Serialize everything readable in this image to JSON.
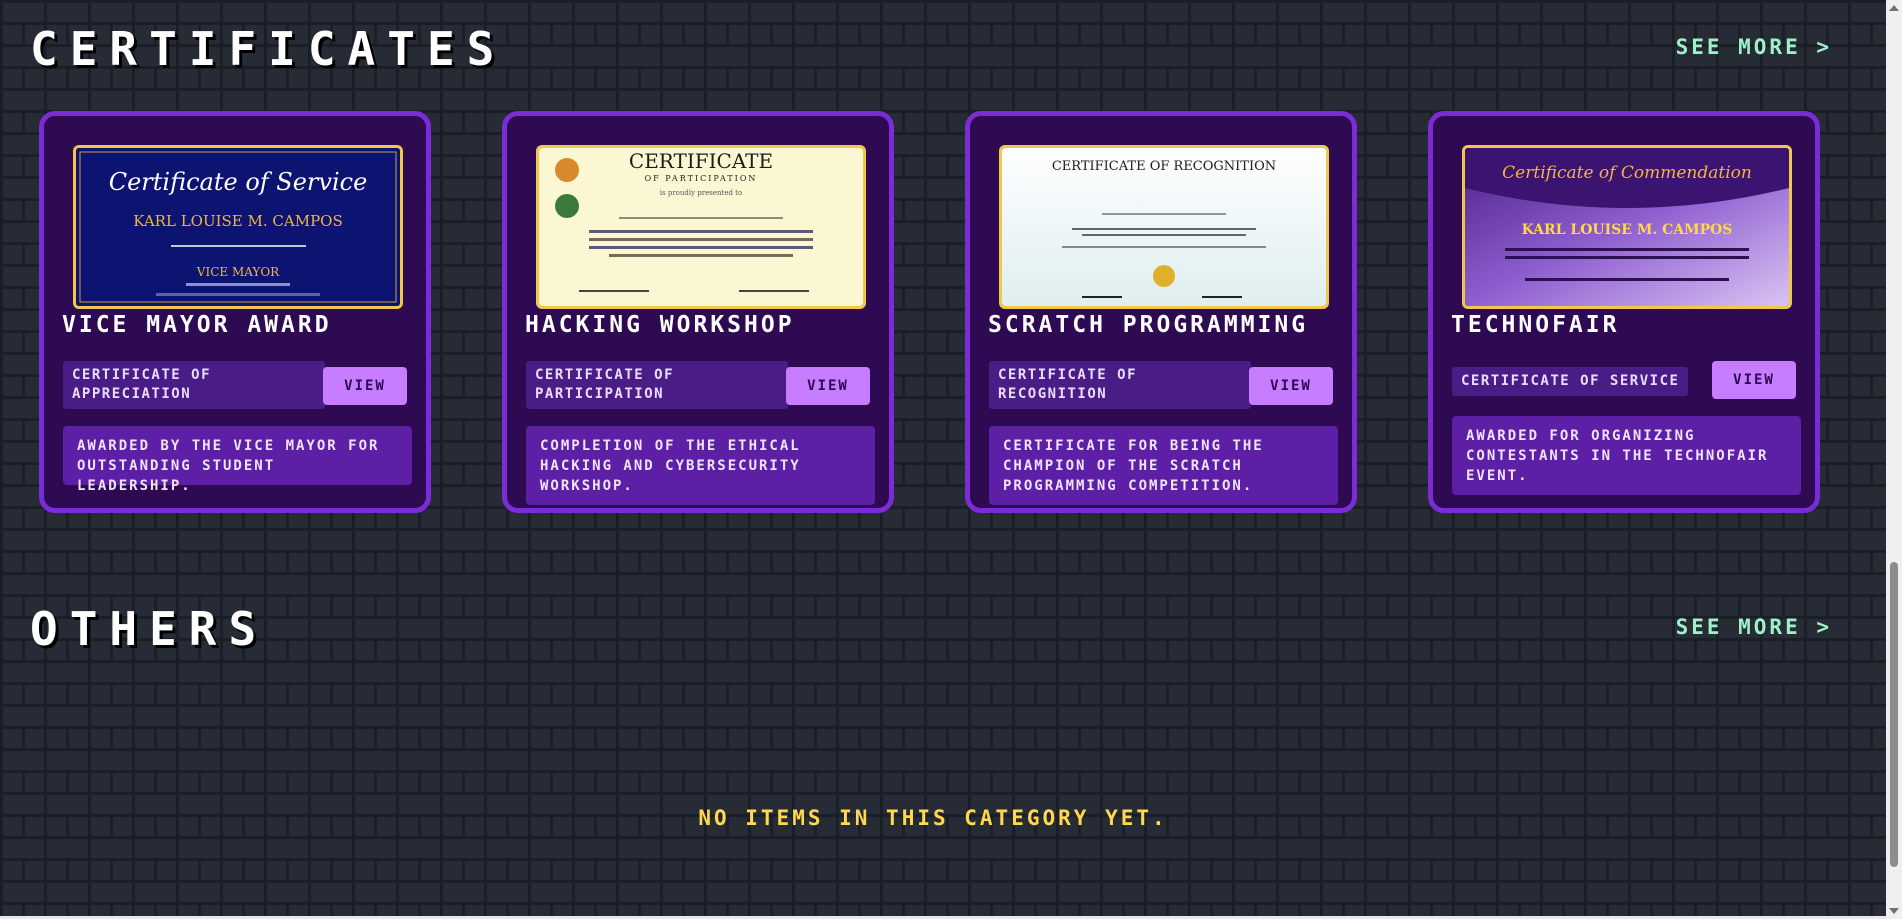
{
  "sections": {
    "certificates": {
      "title": "CERTIFICATES",
      "see_more": "SEE MORE >"
    },
    "others": {
      "title": "OTHERS",
      "see_more": "SEE MORE >",
      "empty_text": "NO ITEMS IN THIS CATEGORY YET."
    }
  },
  "cards": [
    {
      "title": "VICE MAYOR AWARD",
      "type": "CERTIFICATE OF APPRECIATION",
      "view_label": "VIEW",
      "description": "AWARDED BY THE VICE MAYOR FOR OUTSTANDING STUDENT LEADERSHIP.",
      "thumbnail": {
        "heading": "Certificate of Service",
        "name": "KARL LOUISE M. CAMPOS",
        "subtitle": "VICE MAYOR"
      }
    },
    {
      "title": "HACKING WORKSHOP",
      "type": "CERTIFICATE OF PARTICIPATION",
      "view_label": "VIEW",
      "description": "COMPLETION OF THE ETHICAL HACKING AND CYBERSECURITY WORKSHOP.",
      "thumbnail": {
        "heading": "CERTIFICATE",
        "subheading": "OF PARTICIPATION",
        "line": "is proudly presented to"
      }
    },
    {
      "title": "SCRATCH PROGRAMMING",
      "type": "CERTIFICATE OF RECOGNITION",
      "view_label": "VIEW",
      "description": "CERTIFICATE FOR BEING THE CHAMPION OF THE SCRATCH PROGRAMMING COMPETITION.",
      "thumbnail": {
        "heading": "CERTIFICATE OF RECOGNITION"
      }
    },
    {
      "title": "TECHNOFAIR",
      "type": "CERTIFICATE OF SERVICE",
      "view_label": "VIEW",
      "description": "AWARDED FOR ORGANIZING CONTESTANTS IN THE TECHNOFAIR EVENT.",
      "thumbnail": {
        "heading": "Certificate of Commendation",
        "name": "KARL LOUISE M. CAMPOS"
      }
    }
  ],
  "colors": {
    "card_bg": "#2d0a52",
    "card_border": "#7b2cd6",
    "button": "#c77dff",
    "see_more": "#9ef0c6",
    "empty_text": "#ffd84d"
  }
}
